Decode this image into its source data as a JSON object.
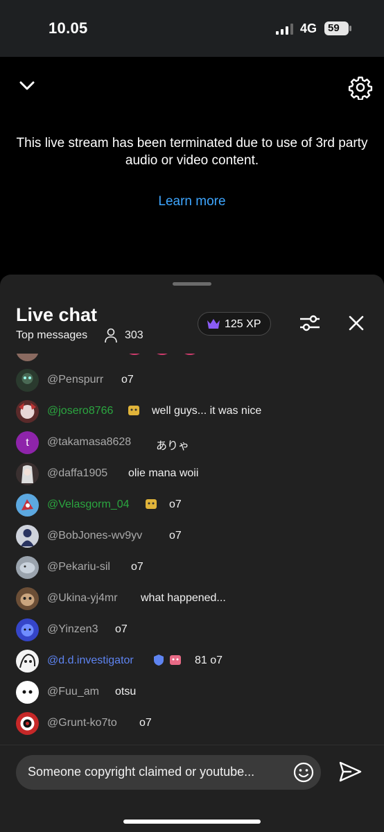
{
  "status_bar": {
    "time": "10.05",
    "network": "4G",
    "battery": "59"
  },
  "player": {
    "message": "This live stream has been terminated due to use of 3rd party audio or video content.",
    "learn_more": "Learn more"
  },
  "chat": {
    "title": "Live chat",
    "mode": "Top messages",
    "viewer_count": "303",
    "xp": "125 XP",
    "messages": [
      {
        "author": "@Penspurr",
        "text": "o7",
        "style": "normal"
      },
      {
        "author": "@josero8766",
        "text": "well guys... it was nice",
        "style": "member"
      },
      {
        "author": "@takamasa8628",
        "text": "ありゃ",
        "style": "normal",
        "initial": "t"
      },
      {
        "author": "@daffa1905",
        "text": "olie mana woii",
        "style": "normal"
      },
      {
        "author": "@Velasgorm_04",
        "text": "o7",
        "style": "member"
      },
      {
        "author": "@BobJones-wv9yv",
        "text": "o7",
        "style": "normal"
      },
      {
        "author": "@Pekariu-sil",
        "text": "o7",
        "style": "normal"
      },
      {
        "author": "@Ukina-yj4mr",
        "text": "what happened...",
        "style": "normal"
      },
      {
        "author": "@Yinzen3",
        "text": "o7",
        "style": "normal"
      },
      {
        "author": "@d.d.investigator",
        "text": "81 o7",
        "style": "mod"
      },
      {
        "author": "@Fuu_am",
        "text": "otsu",
        "style": "normal"
      },
      {
        "author": "@Grunt-ko7to",
        "text": "o7",
        "style": "normal"
      }
    ],
    "input_value": "Someone copyright claimed or youtube..."
  },
  "colors": {
    "link": "#3ea6ff",
    "member": "#2ba640",
    "moderator": "#5e84f1",
    "sheet_bg": "#212121"
  }
}
